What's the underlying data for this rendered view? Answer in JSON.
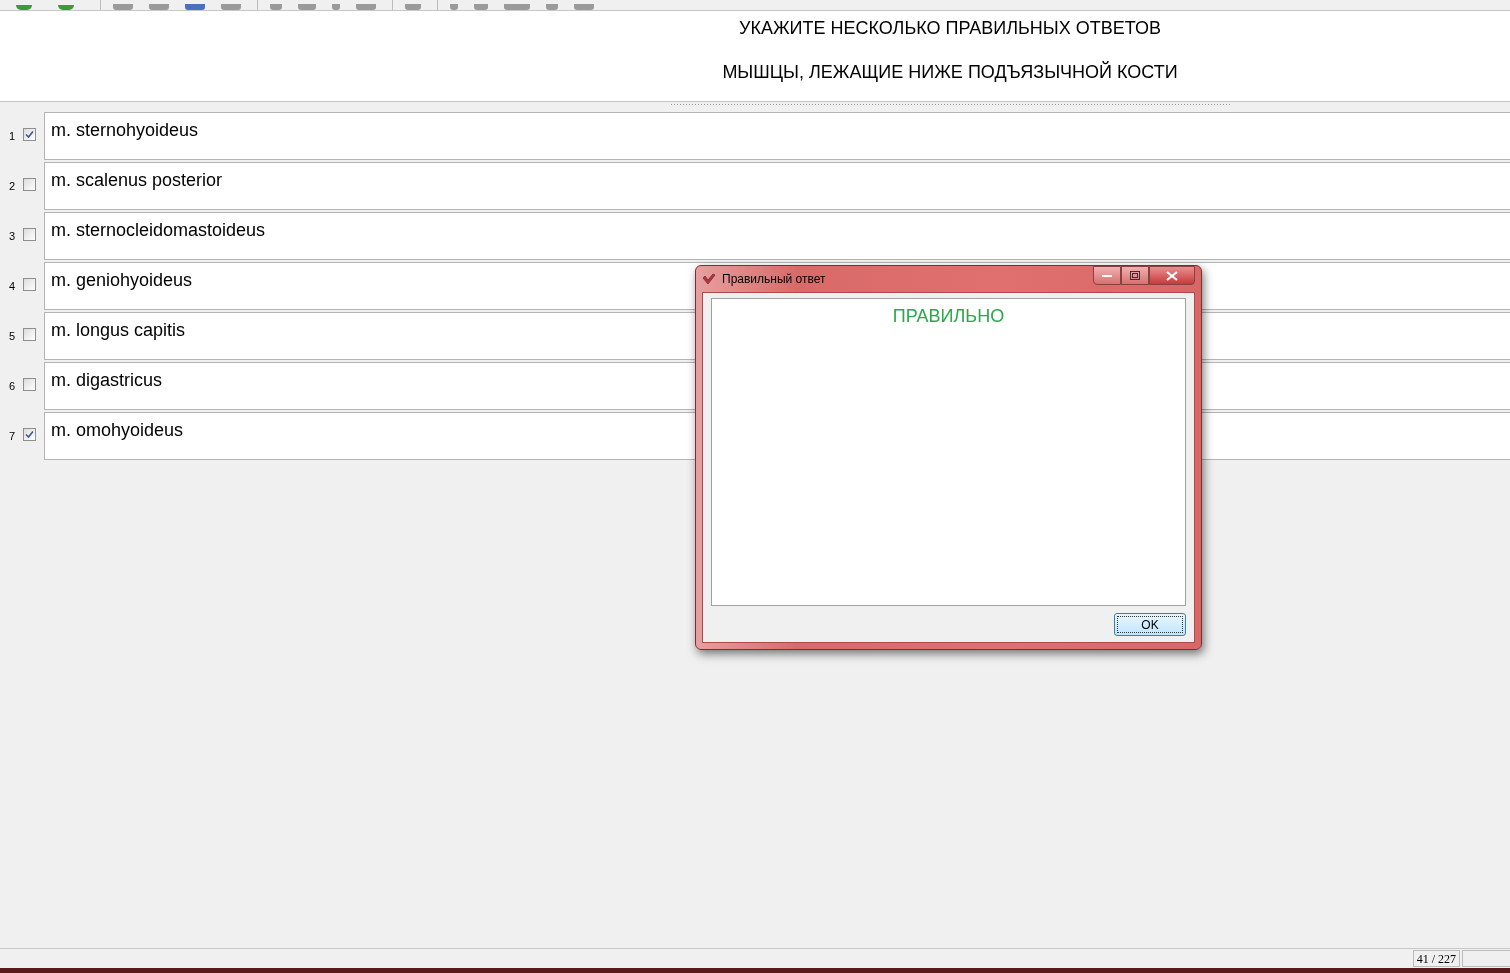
{
  "question": {
    "instruction": "УКАЖИТЕ НЕСКОЛЬКО ПРАВИЛЬНЫХ ОТВЕТОВ",
    "text": "МЫШЦЫ, ЛЕЖАЩИЕ НИЖЕ ПОДЪЯЗЫЧНОЙ КОСТИ"
  },
  "answers": [
    {
      "number": "1",
      "text": "m. sternohyoideus",
      "checked": true
    },
    {
      "number": "2",
      "text": "m. scalenus posterior",
      "checked": false
    },
    {
      "number": "3",
      "text": "m. sternocleidomastoideus",
      "checked": false
    },
    {
      "number": "4",
      "text": "m. geniohyoideus",
      "checked": false
    },
    {
      "number": "5",
      "text": "m. longus capitis",
      "checked": false
    },
    {
      "number": "6",
      "text": "m. digastricus",
      "checked": false
    },
    {
      "number": "7",
      "text": "m. omohyoideus",
      "checked": true
    }
  ],
  "dialog": {
    "title": "Правильный ответ",
    "message": "ПРАВИЛЬНО",
    "button": "OK"
  },
  "status_bar": {
    "progress": "41 / 227"
  }
}
